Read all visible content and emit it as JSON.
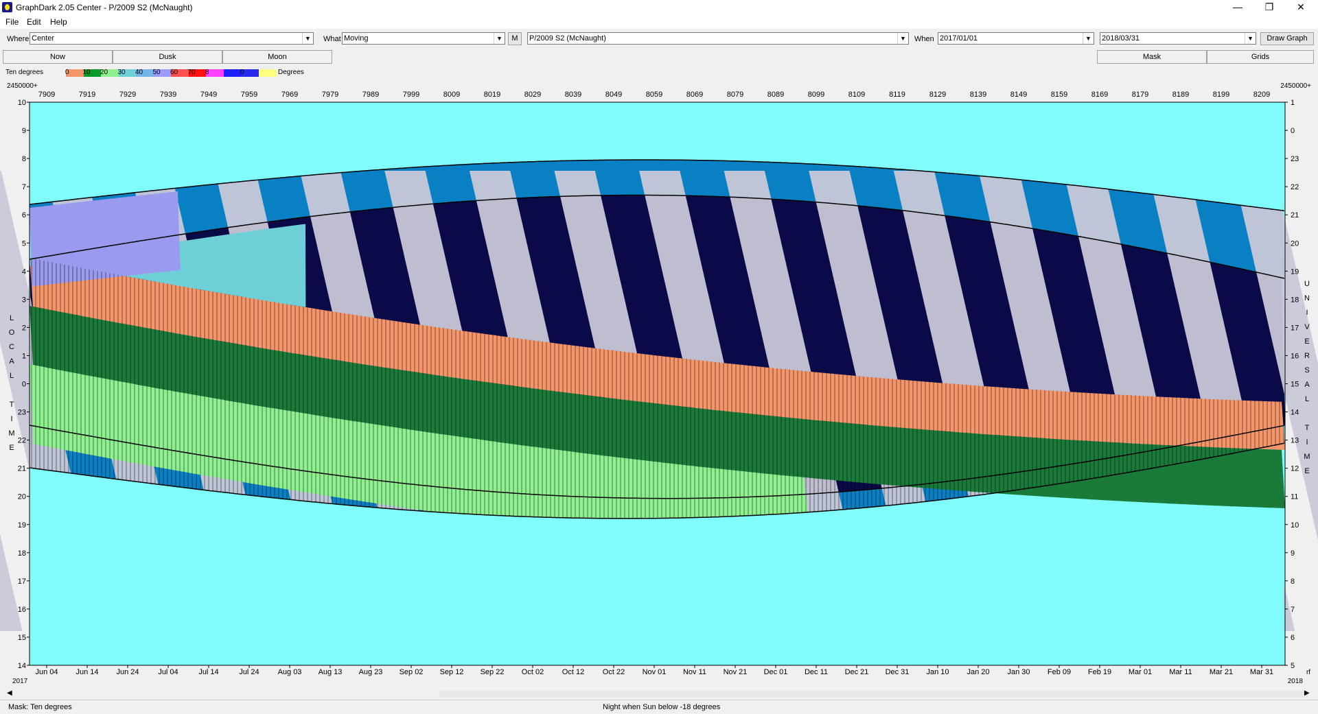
{
  "window": {
    "title": "GraphDark 2.05  Center  -  P/2009 S2 (McNaught)",
    "minimize": "—",
    "maximize": "❐",
    "close": "✕"
  },
  "menu": [
    "File",
    "Edit",
    "Help"
  ],
  "toolbar": {
    "where_label": "Where",
    "where_value": "Center",
    "what_label": "What",
    "what_value": "Moving",
    "m_button": "M",
    "object_value": "P/2009 S2 (McNaught)",
    "when_label": "When",
    "when_start": "2017/01/01",
    "when_end": "2018/03/31",
    "draw_button": "Draw Graph",
    "arrow": "▼"
  },
  "tabs": {
    "now": "Now",
    "dusk": "Dusk",
    "moon": "Moon",
    "mask": "Mask",
    "grids": "Grids"
  },
  "legend": {
    "title": "Ten degrees",
    "unit": "Degrees",
    "swatches": [
      {
        "label": "0",
        "color": "#f4956a"
      },
      {
        "label": "10",
        "color": "#0a9a28"
      },
      {
        "label": "20",
        "color": "#8ef08e"
      },
      {
        "label": "30",
        "color": "#6ecfd6"
      },
      {
        "label": "40",
        "color": "#74b4e8"
      },
      {
        "label": "50",
        "color": "#9a9aff"
      },
      {
        "label": "60",
        "color": "#ff5050"
      },
      {
        "label": "70",
        "color": "#ff1010"
      },
      {
        "label": "8",
        "color": "#ff40ff"
      },
      {
        "label": "",
        "color": "#2020ff"
      },
      {
        "label": "0",
        "color": "#2a2aee"
      },
      {
        "label": "",
        "color": "#ffff80"
      }
    ]
  },
  "graph": {
    "jd_prefix_left": "2450000+",
    "jd_prefix_right": "2450000+",
    "jd_ticks": [
      "7909",
      "7919",
      "7929",
      "7939",
      "7949",
      "7959",
      "7969",
      "7979",
      "7989",
      "7999",
      "8009",
      "8019",
      "8029",
      "8039",
      "8049",
      "8059",
      "8069",
      "8079",
      "8089",
      "8099",
      "8109",
      "8119",
      "8129",
      "8139",
      "8149",
      "8159",
      "8169",
      "8179",
      "8189",
      "8199",
      "8209"
    ],
    "date_ticks": [
      "Jun 04",
      "Jun 14",
      "Jun 24",
      "Jul 04",
      "Jul 14",
      "Jul 24",
      "Aug 03",
      "Aug 13",
      "Aug 23",
      "Sep 02",
      "Sep 12",
      "Sep 22",
      "Oct 02",
      "Oct 12",
      "Oct 22",
      "Nov 01",
      "Nov 11",
      "Nov 21",
      "Dec 01",
      "Dec 11",
      "Dec 21",
      "Dec 31",
      "Jan 10",
      "Jan 20",
      "Jan 30",
      "Feb 09",
      "Feb 19",
      "Mar 01",
      "Mar 11",
      "Mar 21",
      "Mar 31"
    ],
    "year_left": "2017",
    "year_right": "2018",
    "corner_right": "rf",
    "local_time_ticks": [
      "10",
      "9",
      "8",
      "7",
      "6",
      "5",
      "4",
      "3",
      "2",
      "1",
      "0",
      "23",
      "22",
      "21",
      "20",
      "19",
      "18",
      "17",
      "16",
      "15",
      "14"
    ],
    "universal_time_ticks": [
      "1",
      "0",
      "23",
      "22",
      "21",
      "20",
      "19",
      "18",
      "17",
      "16",
      "15",
      "14",
      "13",
      "12",
      "11",
      "10",
      "9",
      "8",
      "7",
      "6",
      "5"
    ],
    "left_axis_letters": [
      "L",
      "O",
      "C",
      "A",
      "L",
      "",
      "T",
      "I",
      "M",
      "E"
    ],
    "right_axis_letters": [
      "U",
      "N",
      "I",
      "V",
      "E",
      "R",
      "S",
      "A",
      "L",
      "",
      "T",
      "I",
      "M",
      "E"
    ],
    "colors": {
      "day": "#80fcfc",
      "twilight": "#0a80c4",
      "moon": "#c8c8d8",
      "night": "#0a0a48",
      "alt0": "#f4956a",
      "alt10": "#1a7a3a",
      "alt20": "#8ef08e",
      "alt30": "#6ecfd6",
      "alt40": "#9a9aee",
      "alt_dark": "#0a5a1a",
      "curve": "#000000"
    }
  },
  "status": {
    "left": "Mask:  Ten degrees",
    "center": "Night when Sun below -18 degrees"
  }
}
